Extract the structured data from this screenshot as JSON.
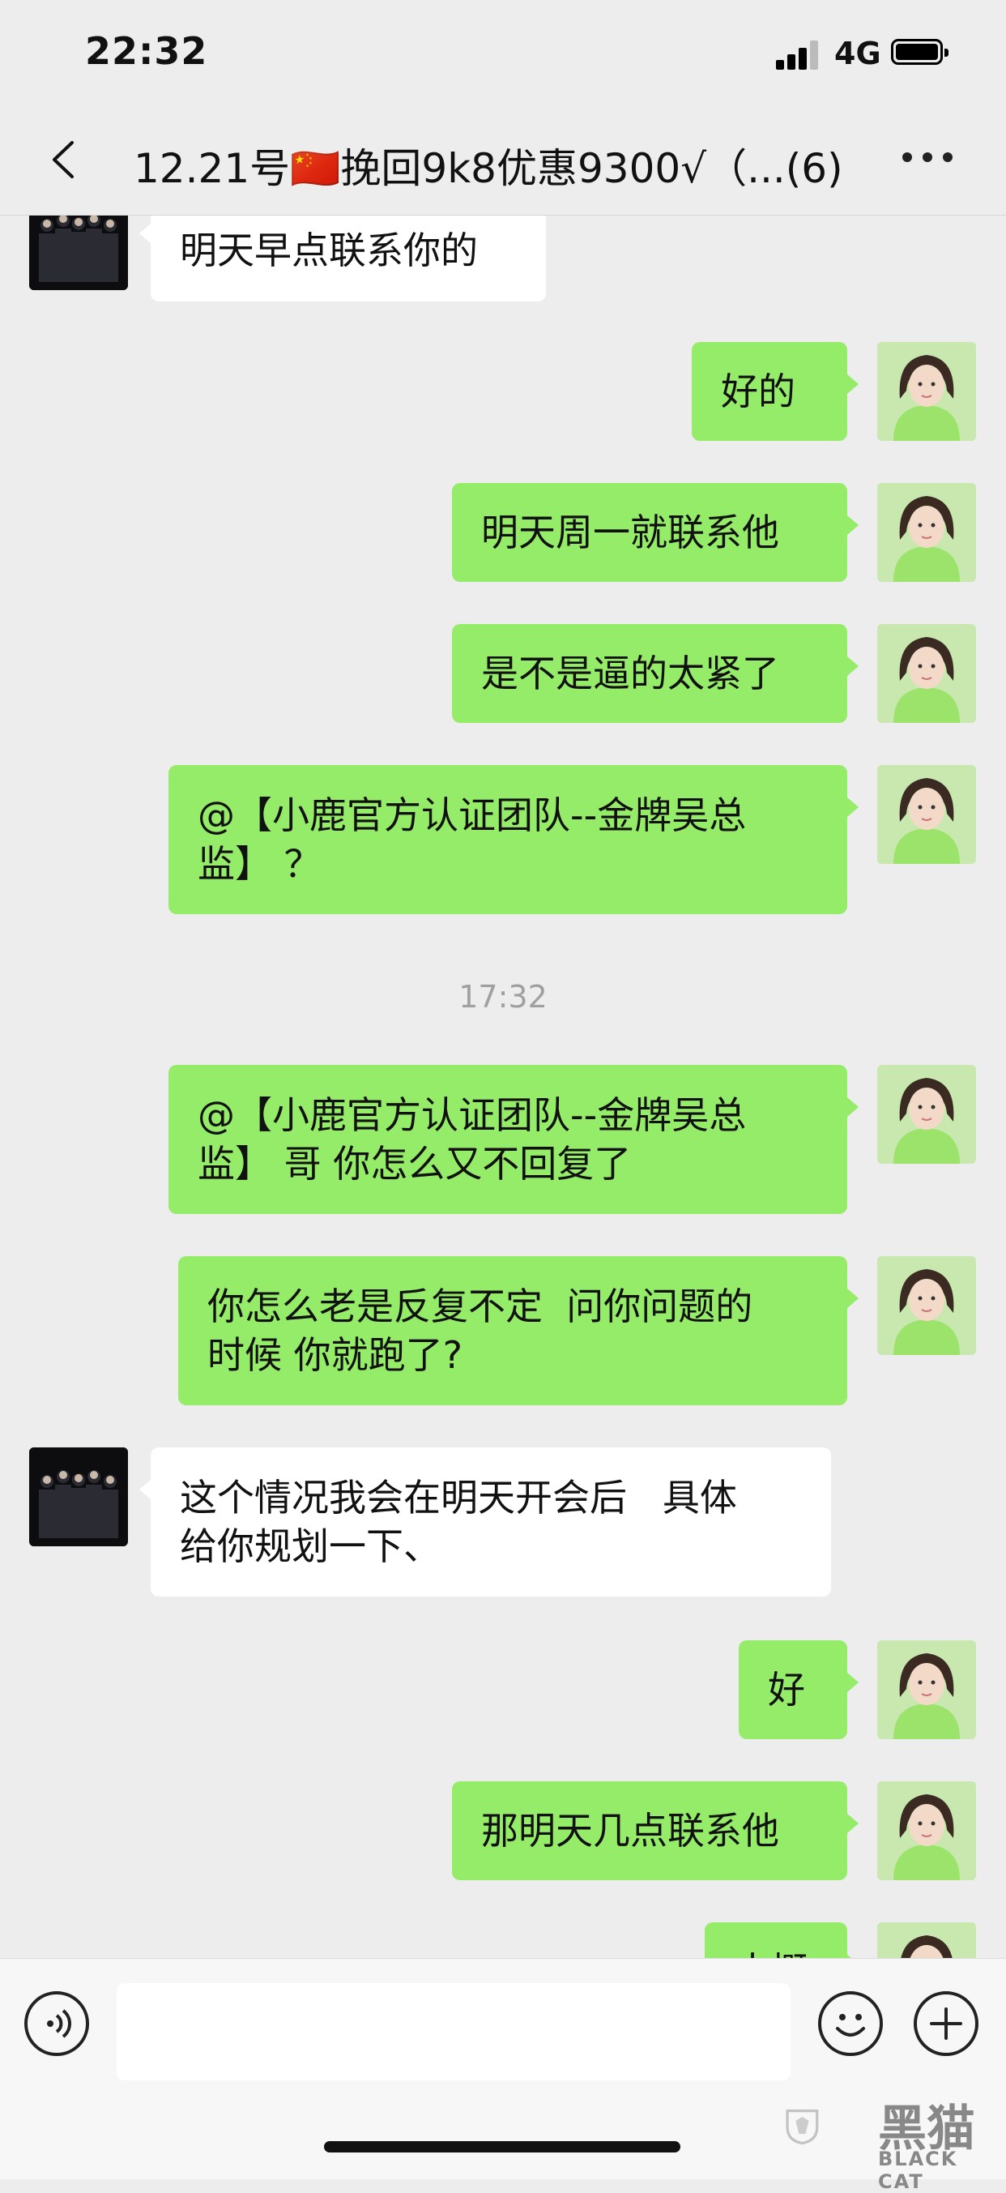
{
  "status_bar": {
    "time": "22:32",
    "network": "4G"
  },
  "nav": {
    "title": "12.21号🇨🇳挽回9k8优惠9300√（...(6)"
  },
  "messages": [
    {
      "side": "in",
      "text": "明天早点联系你的"
    },
    {
      "side": "out",
      "text": "好的"
    },
    {
      "side": "out",
      "text": "明天周一就联系他"
    },
    {
      "side": "out",
      "text": "是不是逼的太紧了"
    },
    {
      "side": "out",
      "text": "@【小鹿官方认证团队--金牌吴总\n监】 ？"
    },
    {
      "side": "out",
      "text": "@【小鹿官方认证团队--金牌吴总\n监】 哥 你怎么又不回复了"
    },
    {
      "side": "out",
      "text": "你怎么老是反复不定  问你问题的\n时候 你就跑了?"
    },
    {
      "side": "in",
      "text": "这个情况我会在明天开会后   具体\n给你规划一下、"
    },
    {
      "side": "out",
      "text": "好"
    },
    {
      "side": "out",
      "text": "那明天几点联系他"
    },
    {
      "side": "out",
      "text": "大概"
    }
  ],
  "timestamp": "17:32",
  "watermark": {
    "text": "黑猫",
    "sub": "BLACK CAT"
  },
  "colors": {
    "out_bubble": "#95ec69",
    "in_bubble": "#ffffff",
    "background": "#ededed"
  }
}
